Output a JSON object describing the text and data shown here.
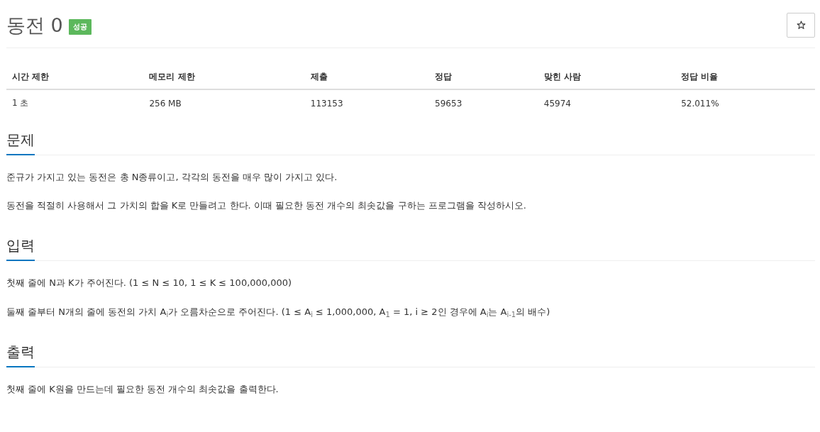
{
  "title": "동전 0",
  "result_badge": "성공",
  "favorite": {
    "on": false
  },
  "info_table": {
    "columns": [
      "시간 제한",
      "메모리 제한",
      "제출",
      "정답",
      "맞힌 사람",
      "정답 비율"
    ],
    "rows": [
      [
        "1 초",
        "256 MB",
        "113153",
        "59653",
        "45974",
        "52.011%"
      ]
    ]
  },
  "sections": [
    {
      "heading": "문제",
      "paragraphs": [
        "준규가 가지고 있는 동전은 총 N종류이고, 각각의 동전을 매우 많이 가지고 있다.",
        "동전을 적절히 사용해서 그 가치의 합을 K로 만들려고 한다. 이때 필요한 동전 개수의 최솟값을 구하는 프로그램을 작성하시오."
      ]
    },
    {
      "heading": "입력",
      "paragraphs": [
        "첫째 줄에 N과 K가 주어진다. (1 ≤ N ≤ 10, 1 ≤ K ≤ 100,000,000)",
        "둘째 줄부터 N개의 줄에 동전의 가치 A$_{i}$가 오름차순으로 주어진다. (1 ≤ A$_{i}$ ≤ 1,000,000, A$_{1}$ = 1, i ≥ 2인 경우에 A$_{i}$는 A$_{i-1}$의 배수)"
      ]
    },
    {
      "heading": "출력",
      "paragraphs": [
        "첫째 줄에 K원을 만드는데 필요한 동전 개수의 최솟값을 출력한다."
      ]
    }
  ]
}
